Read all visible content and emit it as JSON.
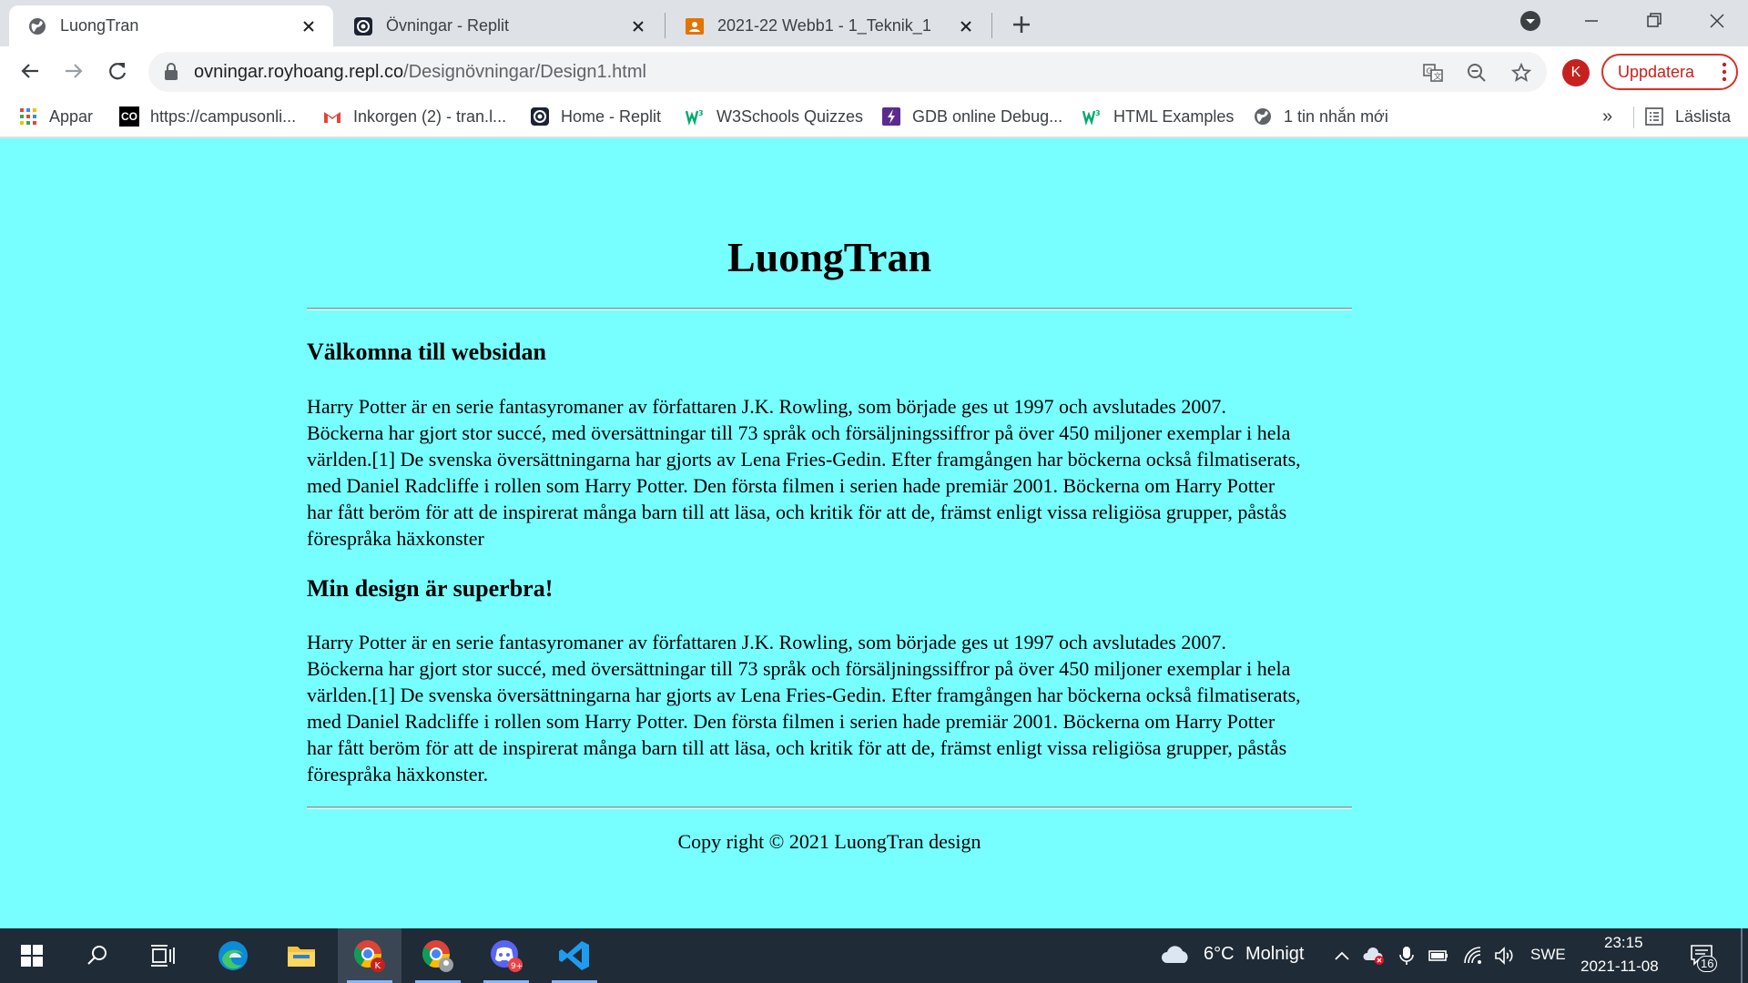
{
  "browser": {
    "tabs": [
      {
        "title": "LuongTran",
        "icon": "globe-icon",
        "active": true
      },
      {
        "title": "Övningar - Replit",
        "icon": "replit-icon",
        "active": false
      },
      {
        "title": "2021-22 Webb1 - 1_Teknik_1",
        "icon": "classroom-icon",
        "active": false
      }
    ],
    "url_host": "ovningar.royhoang.repl.co",
    "url_path": "/Designövningar/Design1.html",
    "profile_initial": "K",
    "update_label": "Uppdatera",
    "bookmarks": [
      {
        "label": "Appar",
        "icon": "apps-grid-icon"
      },
      {
        "label": "https://campusonli...",
        "icon": "co-icon",
        "icon_text": "CO"
      },
      {
        "label": "Inkorgen (2) - tran.l...",
        "icon": "gmail-icon"
      },
      {
        "label": "Home - Replit",
        "icon": "replit-icon"
      },
      {
        "label": "W3Schools Quizzes",
        "icon": "w3schools-icon"
      },
      {
        "label": "GDB online Debug...",
        "icon": "gdb-icon"
      },
      {
        "label": "HTML Examples",
        "icon": "w3schools-icon"
      },
      {
        "label": "1 tin nhắn mới",
        "icon": "globe-icon"
      }
    ],
    "overflow_label": "»",
    "reading_list_label": "Läslista"
  },
  "page": {
    "title": "LuongTran",
    "section1_heading": "Välkomna till websidan",
    "section1_lines": [
      "Harry Potter är en serie fantasyromaner av författaren J.K. Rowling, som började ges ut 1997 och avslutades 2007.",
      "Böckerna har gjort stor succé, med översättningar till 73 språk och försäljningssiffror på över 450 miljoner exemplar i hela",
      "världen.[1] De svenska översättningarna har gjorts av Lena Fries-Gedin. Efter framgången har böckerna också filmatiserats,",
      "med Daniel Radcliffe i rollen som Harry Potter. Den första filmen i serien hade premiär 2001. Böckerna om Harry Potter",
      "har fått beröm för att de inspirerat många barn till att läsa, och kritik för att de, främst enligt vissa religiösa grupper, påstås",
      "förespråka häxkonster"
    ],
    "section2_heading": "Min design är superbra!",
    "section2_lines": [
      "Harry Potter är en serie fantasyromaner av författaren J.K. Rowling, som började ges ut 1997 och avslutades 2007.",
      "Böckerna har gjort stor succé, med översättningar till 73 språk och försäljningssiffror på över 450 miljoner exemplar i hela",
      "världen.[1] De svenska översättningarna har gjorts av Lena Fries-Gedin. Efter framgången har böckerna också filmatiserats,",
      "med Daniel Radcliffe i rollen som Harry Potter. Den första filmen i serien hade premiär 2001. Böckerna om Harry Potter",
      "har fått beröm för att de inspirerat många barn till att läsa, och kritik för att de, främst enligt vissa religiösa grupper, påstås",
      "förespråka häxkonster."
    ],
    "footer": "Copy right © 2021 LuongTran design"
  },
  "taskbar": {
    "weather_temp": "6°C",
    "weather_desc": "Molnigt",
    "language": "SWE",
    "time": "23:15",
    "date": "2021-11-08",
    "notification_count": "16"
  },
  "colors": {
    "page_background": "#77ffff",
    "taskbar": "#1f2b36",
    "update_red": "#d93025"
  }
}
